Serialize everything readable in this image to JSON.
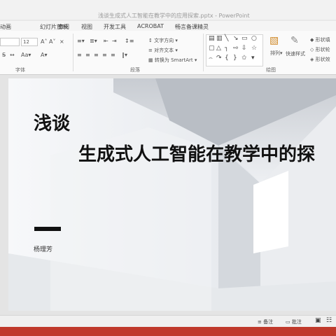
{
  "window": {
    "title": "浅谈生成式人工智能在教学中的应用探索.pptx - PowerPoint"
  },
  "tabs": [
    {
      "label": "动画"
    },
    {
      "label": "幻灯片放映"
    },
    {
      "label": "审阅"
    },
    {
      "label": "视图"
    },
    {
      "label": "开发工具"
    },
    {
      "label": "ACROBAT"
    },
    {
      "label": "畅言备课精灵"
    }
  ],
  "ribbon": {
    "font_size_value": "12",
    "text_direction": "文字方向",
    "align_text": "对齐文本",
    "convert_smartart": "转换为 SmartArt",
    "arrange": "排列",
    "quick_styles": "快速样式",
    "shape_fill": "形状填",
    "shape_outline": "形状轮",
    "shape_effects": "形状效",
    "groups": {
      "font": "字体",
      "paragraph": "段落",
      "drawing": "绘图"
    }
  },
  "slide": {
    "title_line1": "浅谈",
    "title_line2": "生成式人工智能在教学中的探",
    "author": "杨理芳"
  },
  "statusbar": {
    "notes": "备注",
    "comments": "批注"
  },
  "colors": {
    "accent": "#c0392b",
    "title_text": "#111111"
  }
}
